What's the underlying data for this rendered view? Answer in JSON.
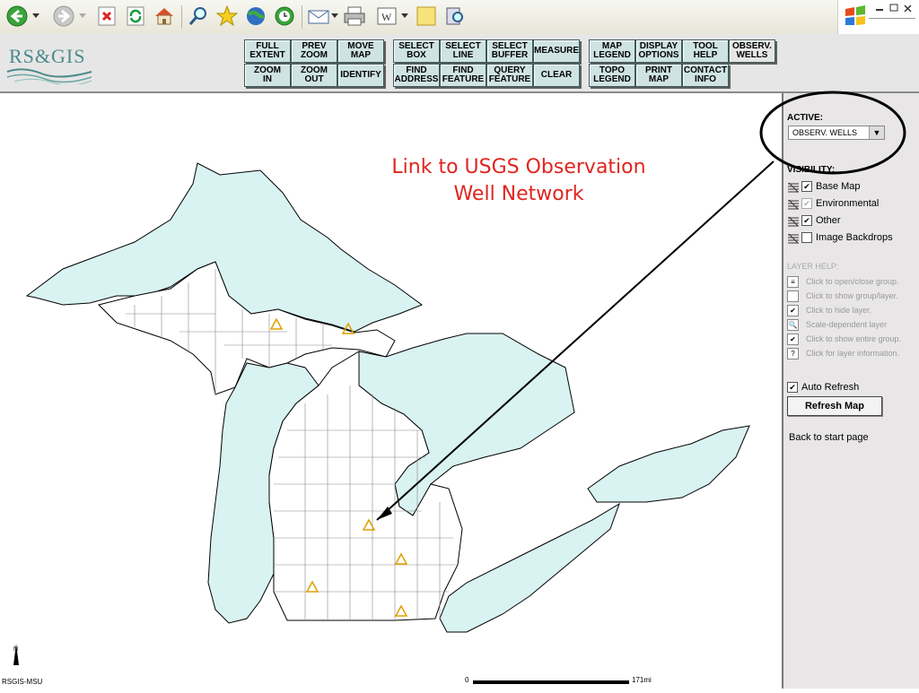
{
  "browser": {
    "icons": [
      "back-icon",
      "back-dropdown-icon",
      "forward-icon",
      "forward-dropdown-icon",
      "stop-icon",
      "refresh-icon",
      "home-icon",
      "search-icon",
      "favorites-icon",
      "media-icon",
      "history-icon",
      "mail-icon",
      "mail-dropdown-icon",
      "print-icon",
      "edit-icon",
      "edit-dropdown-icon",
      "discuss-icon",
      "research-icon"
    ]
  },
  "logo": {
    "text": "RS&GIS"
  },
  "toolbar": {
    "buttons": [
      {
        "label": "FULL\nEXTENT"
      },
      {
        "label": "PREV\nZOOM"
      },
      {
        "label": "MOVE\nMAP"
      },
      {
        "label": "SELECT\nBOX"
      },
      {
        "label": "SELECT\nLINE"
      },
      {
        "label": "SELECT\nBUFFER"
      },
      {
        "label": "MEASURE"
      },
      {
        "label": "MAP\nLEGEND"
      },
      {
        "label": "DISPLAY\nOPTIONS"
      },
      {
        "label": "TOOL\nHELP"
      },
      {
        "label": "OBSERV.\nWELLS"
      },
      {
        "label": "ZOOM\nIN"
      },
      {
        "label": "ZOOM\nOUT"
      },
      {
        "label": "IDENTIFY"
      },
      {
        "label": "FIND\nADDRESS"
      },
      {
        "label": "FIND\nFEATURE"
      },
      {
        "label": "QUERY\nFEATURE"
      },
      {
        "label": "CLEAR"
      },
      {
        "label": "TOPO\nLEGEND"
      },
      {
        "label": "PRINT\nMAP"
      },
      {
        "label": "CONTACT\nINFO"
      }
    ]
  },
  "annotation": {
    "line1": "Link to USGS Observation",
    "line2": "Well Network"
  },
  "panel": {
    "active_label": "ACTIVE:",
    "active_value": "OBSERV. WELLS",
    "visibility_label": "VISIBILITY:",
    "layers": [
      {
        "name": "Base Map",
        "checked": true,
        "dim": false
      },
      {
        "name": "Environmental",
        "checked": true,
        "dim": true
      },
      {
        "name": "Other",
        "checked": true,
        "dim": false
      },
      {
        "name": "Image Backdrops",
        "checked": false,
        "dim": false
      }
    ],
    "layer_help_label": "LAYER HELP:",
    "help": [
      {
        "icon": "group-icon",
        "text": "Click to open/close group."
      },
      {
        "icon": "empty-checkbox-icon",
        "text": "Click to show group/layer."
      },
      {
        "icon": "checked-checkbox-icon",
        "text": "Click to hide layer."
      },
      {
        "icon": "scale-dependent-icon",
        "text": "Scale-dependent layer"
      },
      {
        "icon": "grey-checkbox-icon",
        "text": "Click to show entire group."
      },
      {
        "icon": "info-icon",
        "text": "Click for layer information."
      }
    ],
    "auto_refresh": "Auto Refresh",
    "refresh_button": "Refresh Map",
    "back_link": "Back to start page"
  },
  "map": {
    "scale_start": "0",
    "scale_end": "171mi",
    "credit": "RSGIS-MSU",
    "colors": {
      "water": "#d9f2f2",
      "land": "#ffffff",
      "well": "#e0a000",
      "annotation": "#e0251f"
    }
  }
}
